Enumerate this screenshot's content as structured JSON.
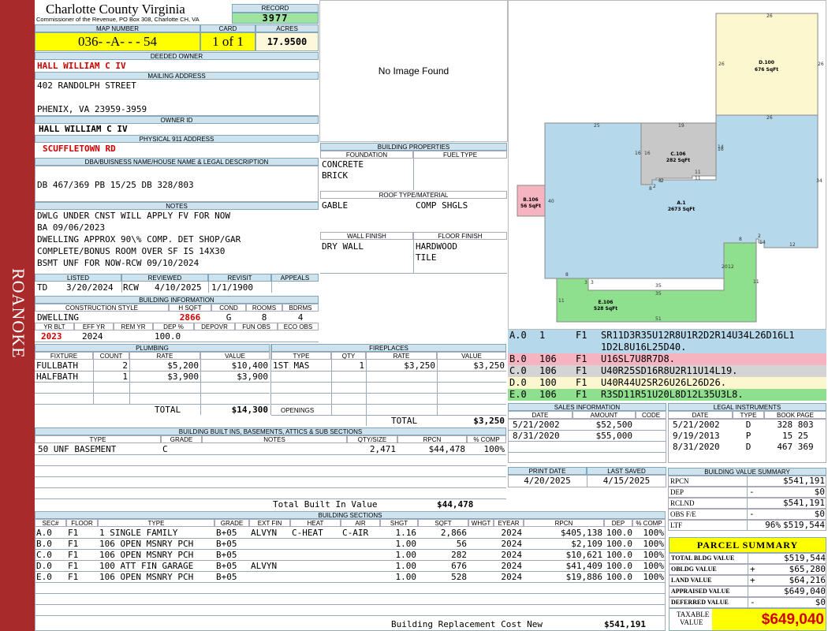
{
  "sidebar": {
    "label": "ROANOKE",
    "color": "#a82a2a"
  },
  "county": {
    "name": "Charlotte County Virginia",
    "office": "Commissioner of the Revenue, PO Box 308, Charlotte CH, VA"
  },
  "record": {
    "label": "RECORD",
    "value": "3977"
  },
  "map": {
    "label": "MAP NUMBER",
    "value": "036- -A- - - 54"
  },
  "card": {
    "label": "CARD",
    "value": "1 of 1"
  },
  "acres": {
    "label": "ACRES",
    "value": "17.9500"
  },
  "owner": {
    "label": "DEEDED OWNER",
    "value": "HALL WILLIAM C IV"
  },
  "mailing": {
    "label": "MAILING ADDRESS",
    "line1": "402 RANDOLPH STREET",
    "line2": "PHENIX, VA 23959-3959"
  },
  "owner_id": {
    "label": "OWNER ID",
    "value": "HALL WILLIAM C IV"
  },
  "physical": {
    "label": "PHYSICAL 911 ADDRESS",
    "value": "SCUFFLETOWN RD"
  },
  "dba": {
    "label": "DBA/BUISNESS NAME/HOUSE NAME & LEGAL DESCRIPTION",
    "value": "DB 467/369 PB 15/25 DB 328/803"
  },
  "notes": {
    "label": "NOTES",
    "lines": [
      "DWLG UNDER CNST WILL APPLY FV FOR NOW",
      "BA 09/06/2023",
      "DWELLING APPROX 90\\% COMP. DET SHOP/GAR",
      "COMPLETE/BONUS ROOM OVER SF IS 14X30",
      "BSMT UNF FOR NOW-RCW 09/10/2024"
    ]
  },
  "dates": {
    "listed_label": "LISTED",
    "reviewed_label": "REVIEWED",
    "revisit_label": "REVISIT",
    "appeals_label": "APPEALS",
    "listed_by": "TD",
    "listed": "3/20/2024",
    "reviewed_by": "RCW",
    "reviewed": "4/10/2025",
    "revisit": "1/1/1900"
  },
  "building_info": {
    "label": "BUILDING INFORMATION",
    "h_construction": "CONSTRUCTION STYLE",
    "h_sqft": "H SQFT",
    "h_cond": "COND",
    "h_rooms": "ROOMS",
    "h_bdrms": "BDRMS",
    "construction": "DWELLING",
    "sqft": "2866",
    "cond": "G",
    "rooms": "8",
    "bdrms": "4",
    "h_yrblt": "YR BLT",
    "h_effyr": "EFF YR",
    "h_remyr": "REM YR",
    "h_dep": "DEP %",
    "h_depovr": "DEPOVR",
    "h_funobs": "FUN OBS",
    "h_ecoobs": "ECO OBS",
    "yrblt": "2023",
    "effyr": "2024",
    "dep": "100.0"
  },
  "photo": {
    "text": "No Image Found"
  },
  "building_props": {
    "label": "BUILDING PROPERTIES",
    "h_foundation": "FOUNDATION",
    "h_fuel": "FUEL TYPE",
    "foundation1": "CONCRETE",
    "foundation2": "BRICK",
    "h_roof": "ROOF TYPE/MATERIAL",
    "roof_type": "GABLE",
    "roof_material": "COMP SHGLS",
    "h_wall": "WALL FINISH",
    "h_floor": "FLOOR FINISH",
    "wall": "DRY WALL",
    "floor1": "HARDWOOD",
    "floor2": "TILE"
  },
  "plumbing": {
    "label": "PLUMBING",
    "h_fixture": "FIXTURE",
    "h_count": "COUNT",
    "h_rate": "RATE",
    "h_value": "VALUE",
    "rows": [
      [
        "FULLBATH",
        "2",
        "$5,200",
        "$10,400"
      ],
      [
        "HALFBATH",
        "1",
        "$3,900",
        "$3,900"
      ]
    ],
    "total_label": "TOTAL",
    "total": "$14,300"
  },
  "fireplaces": {
    "label": "FIREPLACES",
    "h_type": "TYPE",
    "h_qty": "QTY",
    "h_rate": "RATE",
    "h_value": "VALUE",
    "rows": [
      [
        "1ST MAS",
        "1",
        "$3,250",
        "$3,250"
      ]
    ],
    "openings_label": "OPENINGS",
    "total_label": "TOTAL",
    "total": "$3,250"
  },
  "sketch": {
    "sections": [
      {
        "id": "A",
        "label": "A.1",
        "area": "2673 SqFt",
        "color": "#b5d8ea"
      },
      {
        "id": "B",
        "label": "B.106",
        "area": "56 SqFt",
        "color": "#f6b4c1"
      },
      {
        "id": "C",
        "label": "C.106",
        "area": "282 SqFt",
        "color": "#c8c8c8"
      },
      {
        "id": "D",
        "label": "D.100",
        "area": "676 SqFt",
        "color": "#fdf7cf"
      },
      {
        "id": "E",
        "label": "E.106",
        "area": "528 SqFt",
        "color": "#8ee08e"
      }
    ],
    "dims": [
      "26",
      "26",
      "26",
      "26",
      "25",
      "19",
      "16",
      "16",
      "14",
      "16",
      "8",
      "2",
      "2",
      "11",
      "11",
      "8",
      "34",
      "40",
      "8",
      "2",
      "14",
      "12",
      "12",
      "20",
      "11",
      "8",
      "3",
      "3",
      "35",
      "35",
      "11",
      "51"
    ]
  },
  "vectors": [
    {
      "sec": "A.0",
      "code": "1",
      "floor": "F1",
      "path": "SR11D3R35U12R8U1R2D2R14U34L26D16L1",
      "path2": "1D2L8U16L25D40.",
      "color": "#b5d8ea"
    },
    {
      "sec": "B.0",
      "code": "106",
      "floor": "F1",
      "path": "U16SL7U8R7D8.",
      "color": "#f6b4c1"
    },
    {
      "sec": "C.0",
      "code": "106",
      "floor": "F1",
      "path": "U40R25SD16R8U2R11U14L19.",
      "color": "#d4d4d4"
    },
    {
      "sec": "D.0",
      "code": "100",
      "floor": "F1",
      "path": "U40R44U2SR26U26L26D26.",
      "color": "#fdf7cf"
    },
    {
      "sec": "E.0",
      "code": "106",
      "floor": "F1",
      "path": "R3SD11R51U20L8D12L35U3L8.",
      "color": "#8ee08e"
    }
  ],
  "sales": {
    "label": "SALES INFORMATION",
    "h_date": "DATE",
    "h_amount": "AMOUNT",
    "h_code": "CODE",
    "rows": [
      [
        "5/21/2002",
        "$52,500",
        ""
      ],
      [
        "8/31/2020",
        "$55,000",
        ""
      ]
    ]
  },
  "legal": {
    "label": "LEGAL INSTRUMENTS",
    "h_date": "DATE",
    "h_type": "TYPE",
    "h_book": "BOOK PAGE",
    "rows": [
      [
        "5/21/2002",
        "D",
        "328 803"
      ],
      [
        "9/19/2013",
        "P",
        "15 25"
      ],
      [
        "8/31/2020",
        "D",
        "467 369"
      ]
    ]
  },
  "print": {
    "h_print": "PRINT DATE",
    "h_saved": "LAST SAVED",
    "print": "4/20/2025",
    "saved": "4/15/2025"
  },
  "builtins": {
    "label": "BUILDING BUILT INS, BASEMENTS, ATTICS & SUB SECTIONS",
    "h_type": "TYPE",
    "h_grade": "GRADE",
    "h_notes": "NOTES",
    "h_qty": "QTY/SIZE",
    "h_rpcn": "RPCN",
    "h_comp": "% COMP",
    "rows": [
      [
        "50 UNF BASEMENT",
        "C",
        "",
        "2,471",
        "$44,478",
        "100%"
      ]
    ],
    "total_label": "Total Built In Value",
    "total": "$44,478"
  },
  "value_summary": {
    "label": "BUILDING VALUE SUMMARY",
    "rows": [
      [
        "RPCN",
        "",
        "$541,191"
      ],
      [
        "DEP",
        "-",
        "$0"
      ],
      [
        "RCLND",
        "",
        "$541,191"
      ],
      [
        "OBS F/E",
        "-",
        "$0"
      ],
      [
        "LTF",
        "96%",
        "$519,544"
      ]
    ]
  },
  "sections": {
    "label": "BUILDING SECTIONS",
    "h_sec": "SEC#",
    "h_floor": "FLOOR",
    "h_type": "TYPE",
    "h_grade": "GRADE",
    "h_extfin": "EXT FIN",
    "h_heat": "HEAT",
    "h_air": "AIR",
    "h_shgt": "SHGT",
    "h_sqft": "SQFT",
    "h_whgt": "WHGT",
    "h_eyear": "EYEAR",
    "h_rpcn": "RPCN",
    "h_dep": "DEP",
    "h_comp": "% COMP",
    "rows": [
      [
        "A.0",
        "F1",
        "1 SINGLE FAMILY",
        "B+05",
        "ALVYN",
        "C-HEAT",
        "C-AIR",
        "1.16",
        "2,866",
        "",
        "2024",
        "$405,138",
        "100.0",
        "100%"
      ],
      [
        "B.0",
        "F1",
        "106 OPEN MSNRY PCH",
        "B+05",
        "",
        "",
        "",
        "1.00",
        "56",
        "",
        "2024",
        "$2,109",
        "100.0",
        "100%"
      ],
      [
        "C.0",
        "F1",
        "106 OPEN MSNRY PCH",
        "B+05",
        "",
        "",
        "",
        "1.00",
        "282",
        "",
        "2024",
        "$10,621",
        "100.0",
        "100%"
      ],
      [
        "D.0",
        "F1",
        "100 ATT FIN GARAGE",
        "B+05",
        "ALVYN",
        "",
        "",
        "1.00",
        "676",
        "",
        "2024",
        "$41,409",
        "100.0",
        "100%"
      ],
      [
        "E.0",
        "F1",
        "106 OPEN MSNRY PCH",
        "B+05",
        "",
        "",
        "",
        "1.00",
        "528",
        "",
        "2024",
        "$19,886",
        "100.0",
        "100%"
      ]
    ],
    "total_label": "Building Replacement Cost New",
    "total": "$541,191"
  },
  "parcel": {
    "label": "PARCEL SUMMARY",
    "rows": [
      [
        "TOTAL BLDG VALUE",
        "",
        "$519,544"
      ],
      [
        "OBLDG VALUE",
        "+",
        "$65,280"
      ],
      [
        "LAND VALUE",
        "+",
        "$64,216"
      ],
      [
        "APPRAISED VALUE",
        "",
        "$649,040"
      ],
      [
        "DEFERRED VALUE",
        "-",
        "$0"
      ]
    ],
    "taxable_label1": "TAXABLE",
    "taxable_label2": "VALUE",
    "taxable": "$649,040",
    "highlight": "#ffff00"
  }
}
